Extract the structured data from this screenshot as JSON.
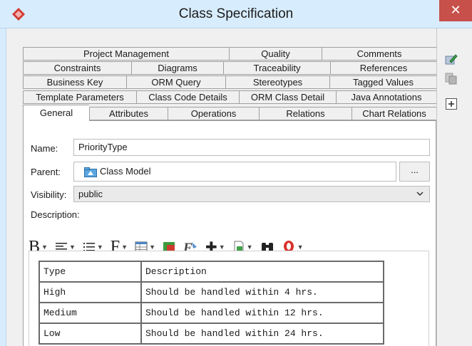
{
  "window": {
    "title": "Class Specification",
    "close_glyph": "✕"
  },
  "tabs": {
    "row1": [
      "Project Management",
      "Quality",
      "Comments"
    ],
    "row2": [
      "Constraints",
      "Diagrams",
      "Traceability",
      "References"
    ],
    "row3": [
      "Business Key",
      "ORM Query",
      "Stereotypes",
      "Tagged Values"
    ],
    "row4": [
      "Template Parameters",
      "Class Code Details",
      "ORM Class Detail",
      "Java Annotations"
    ],
    "row5": [
      "General",
      "Attributes",
      "Operations",
      "Relations",
      "Chart Relations"
    ],
    "active": "General"
  },
  "form": {
    "name_label": "Name:",
    "name_value": "PriorityType",
    "parent_label": "Parent:",
    "parent_value": "Class Model",
    "parent_button": "...",
    "visibility_label": "Visibility:",
    "visibility_value": "public",
    "description_label": "Description:"
  },
  "toolbar": {
    "bold_glyph": "B",
    "font_glyph": "F",
    "insert_glyph": "✚"
  },
  "description_table": {
    "rows": [
      [
        "Type",
        "Description"
      ],
      [
        "High",
        "Should be handled within 4 hrs."
      ],
      [
        "Medium",
        "Should be handled within 12 hrs."
      ],
      [
        "Low",
        "Should be handled within 24 hrs."
      ]
    ]
  },
  "icons": {
    "app": "diamond-logo-icon",
    "side": [
      "edit-icon",
      "duplicate-icon",
      "expand-icon"
    ]
  },
  "colors": {
    "titlebar": "#d7ecfd",
    "close": "#c7504a",
    "accent": "#2a7fd4"
  }
}
